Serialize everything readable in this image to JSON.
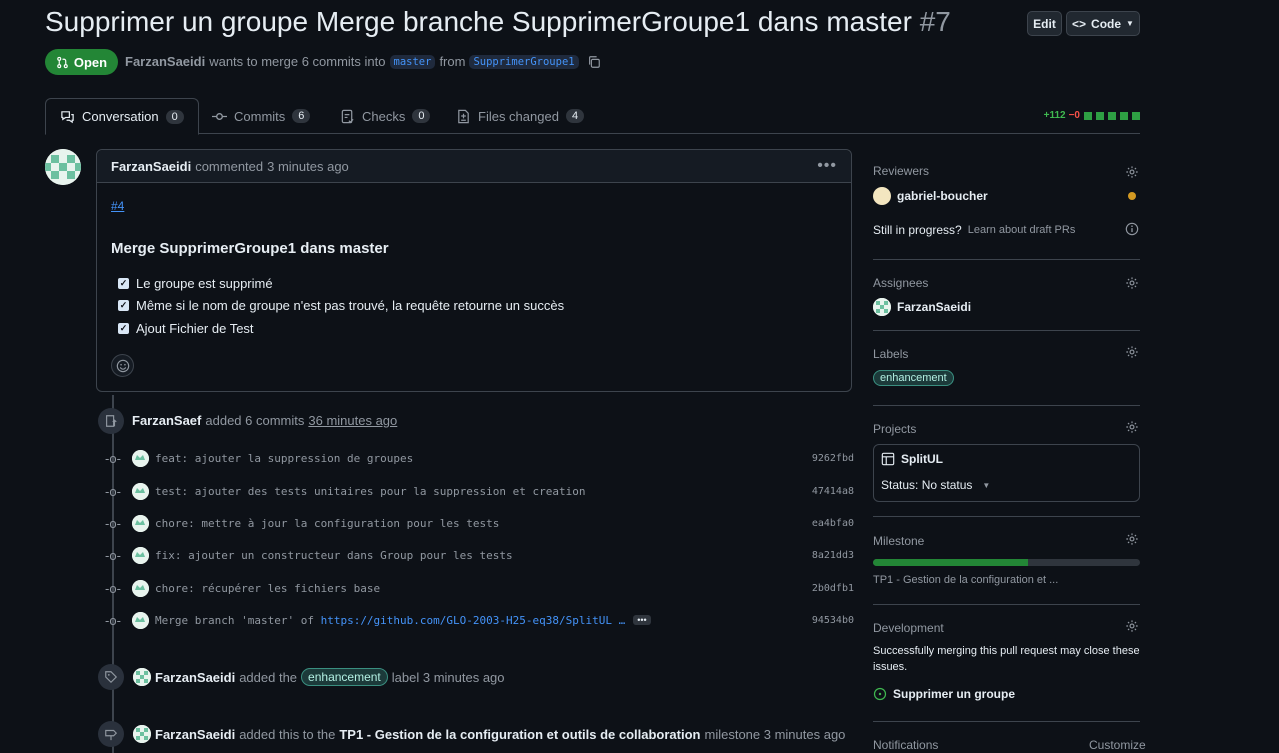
{
  "header": {
    "title": "Supprimer un groupe Merge branche SupprimerGroupe1 dans master",
    "number": "#7",
    "edit_label": "Edit",
    "code_label": "Code",
    "state_label": "Open",
    "author": "FarzanSaeidi",
    "meta_text": "wants to merge 6 commits into",
    "base_branch": "master",
    "from_text": "from",
    "head_branch": "SupprimerGroupe1"
  },
  "tabs": [
    {
      "label": "Conversation",
      "count": "0"
    },
    {
      "label": "Commits",
      "count": "6"
    },
    {
      "label": "Checks",
      "count": "0"
    },
    {
      "label": "Files changed",
      "count": "4"
    }
  ],
  "diffstat": {
    "added": "+112",
    "removed": "−0"
  },
  "comment": {
    "author": "FarzanSaeidi",
    "action": "commented",
    "time": "3 minutes ago",
    "link": "#4",
    "heading": "Merge SupprimerGroupe1 dans master",
    "tasks": [
      "Le groupe est supprimé",
      "Même si le nom de groupe n'est pas trouvé, la requête retourne un succès",
      "Ajout Fichier de Test"
    ]
  },
  "timeline": {
    "commits_event": {
      "author": "FarzanSaef",
      "text": "added 6 commits",
      "time": "36 minutes ago"
    },
    "commits": [
      {
        "message": "feat: ajouter la suppression de groupes",
        "sha": "9262fbd"
      },
      {
        "message": "test: ajouter des tests unitaires pour la suppression et creation",
        "sha": "47414a8"
      },
      {
        "message": "chore: mettre à jour la configuration pour les tests",
        "sha": "ea4bfa0"
      },
      {
        "message": "fix: ajouter un constructeur dans Group pour les tests",
        "sha": "8a21dd3"
      },
      {
        "message": "chore: récupérer les fichiers base",
        "sha": "2b0dfb1"
      },
      {
        "message": "Merge branch 'master' of",
        "link": "https://github.com/GLO-2003-H25-eq38/SplitUL …",
        "sha": "94534b0"
      }
    ],
    "label_event": {
      "author": "FarzanSaeidi",
      "pre": "added the",
      "label": "enhancement",
      "post": "label 3 minutes ago"
    },
    "milestone_event": {
      "author": "FarzanSaeidi",
      "pre": "added this to the",
      "milestone": "TP1 - Gestion de la configuration et outils de collaboration",
      "post": "milestone 3 minutes ago"
    }
  },
  "sidebar": {
    "reviewers_h": "Reviewers",
    "reviewer": "gabriel-boucher",
    "draft_q": "Still in progress?",
    "draft_link": "Learn about draft PRs",
    "assignees_h": "Assignees",
    "assignee": "FarzanSaeidi",
    "labels_h": "Labels",
    "label": "enhancement",
    "projects_h": "Projects",
    "project": "SplitUL",
    "project_status": "Status: No status",
    "milestone_h": "Milestone",
    "milestone_progress": 0.58,
    "milestone": "TP1 - Gestion de la configuration et ...",
    "development_h": "Development",
    "development_text": "Successfully merging this pull request may close these issues.",
    "development_issue": "Supprimer un groupe",
    "notifications_h": "Notifications",
    "customize": "Customize"
  },
  "colors": {
    "accent": "#4493f8",
    "open": "#238636",
    "reviewer_pending": "#d29922"
  }
}
